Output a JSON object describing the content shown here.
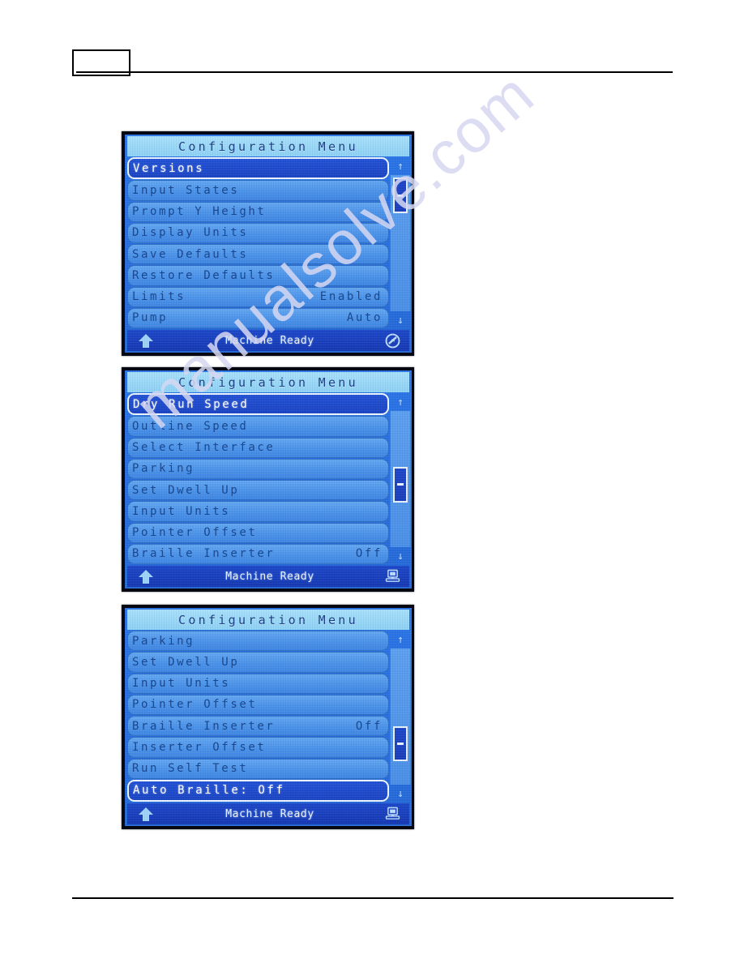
{
  "page": {
    "header_box_label": "",
    "watermark": "manualsolve.com"
  },
  "screens": [
    {
      "id": "screen-1",
      "title": "Configuration Menu",
      "rows": [
        {
          "label": "Versions",
          "value": "",
          "selected": true
        },
        {
          "label": "Input States",
          "value": "",
          "selected": false
        },
        {
          "label": "Prompt Y Height",
          "value": "",
          "selected": false
        },
        {
          "label": "Display Units",
          "value": "",
          "selected": false
        },
        {
          "label": "Save Defaults",
          "value": "",
          "selected": false
        },
        {
          "label": "Restore Defaults",
          "value": "",
          "selected": false
        },
        {
          "label": "Limits",
          "value": "Enabled",
          "selected": false
        },
        {
          "label": "Pump",
          "value": "Auto",
          "selected": false
        }
      ],
      "scrollbar": {
        "up_arrow": "↑",
        "down_arrow": "↓",
        "thumb_top_pct": 2,
        "thumb_height_pct": 26
      },
      "status": {
        "text": "Machine Ready",
        "left_icon": "up-arrow-icon",
        "right_icon": "no-connection-icon"
      }
    },
    {
      "id": "screen-2",
      "title": "Configuration Menu",
      "rows": [
        {
          "label": "Dry Run Speed",
          "value": "",
          "selected": true
        },
        {
          "label": "Outline Speed",
          "value": "",
          "selected": false
        },
        {
          "label": "Select Interface",
          "value": "",
          "selected": false
        },
        {
          "label": "Parking",
          "value": "",
          "selected": false
        },
        {
          "label": "Set Dwell Up",
          "value": "",
          "selected": false
        },
        {
          "label": "Input Units",
          "value": "",
          "selected": false
        },
        {
          "label": "Pointer Offset",
          "value": "",
          "selected": false
        },
        {
          "label": "Braille Inserter",
          "value": "Off",
          "selected": false
        }
      ],
      "scrollbar": {
        "up_arrow": "↑",
        "down_arrow": "↓",
        "thumb_top_pct": 41,
        "thumb_height_pct": 26
      },
      "status": {
        "text": "Machine Ready",
        "left_icon": "up-arrow-icon",
        "right_icon": "computer-icon"
      }
    },
    {
      "id": "screen-3",
      "title": "Configuration Menu",
      "rows": [
        {
          "label": "Parking",
          "value": "",
          "selected": false
        },
        {
          "label": "Set Dwell Up",
          "value": "",
          "selected": false
        },
        {
          "label": "Input Units",
          "value": "",
          "selected": false
        },
        {
          "label": "Pointer Offset",
          "value": "",
          "selected": false
        },
        {
          "label": "Braille Inserter",
          "value": "Off",
          "selected": false
        },
        {
          "label": "Inserter Offset",
          "value": "",
          "selected": false
        },
        {
          "label": "Run Self Test",
          "value": "",
          "selected": false
        },
        {
          "label": "Auto Braille: Off",
          "value": "",
          "selected": true
        }
      ],
      "scrollbar": {
        "up_arrow": "↑",
        "down_arrow": "↓",
        "thumb_top_pct": 57,
        "thumb_height_pct": 26
      },
      "status": {
        "text": "Machine Ready",
        "left_icon": "up-arrow-icon",
        "right_icon": "computer-icon"
      }
    }
  ]
}
